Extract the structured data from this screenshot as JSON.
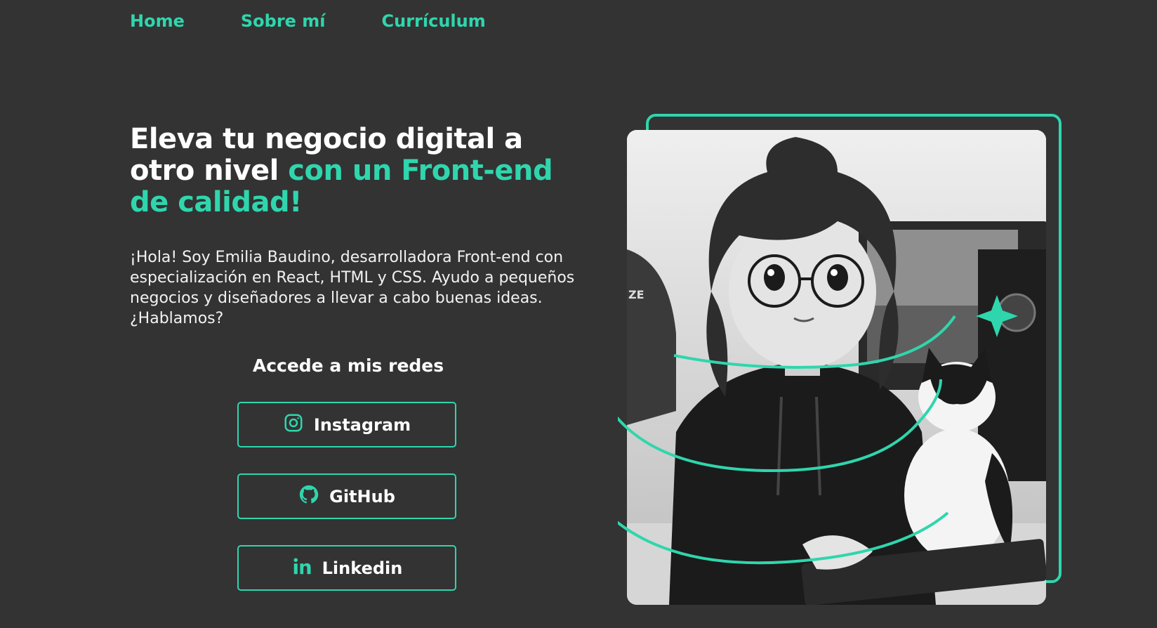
{
  "nav": {
    "items": [
      "Home",
      "Sobre mí",
      "Currículum"
    ]
  },
  "hero": {
    "title_plain": "Eleva tu negocio digital a otro nivel ",
    "title_accent": "con un Front-end de calidad!",
    "intro": "¡Hola! Soy Emilia Baudino, desarrolladora Front-end con especialización en React, HTML y CSS. Ayudo a pequeños negocios y diseñadores a llevar a cabo buenas ideas. ¿Hablamos?"
  },
  "social": {
    "title": "Accede a mis redes",
    "buttons": [
      {
        "label": "Instagram",
        "icon": "instagram-icon"
      },
      {
        "label": "GitHub",
        "icon": "github-icon"
      },
      {
        "label": "Linkedin",
        "icon": "linkedin-icon"
      }
    ]
  },
  "illustration": {
    "sticker_text": "ZE"
  },
  "colors": {
    "background": "#333333",
    "accent": "#2fd6ad",
    "text": "#ffffff"
  }
}
